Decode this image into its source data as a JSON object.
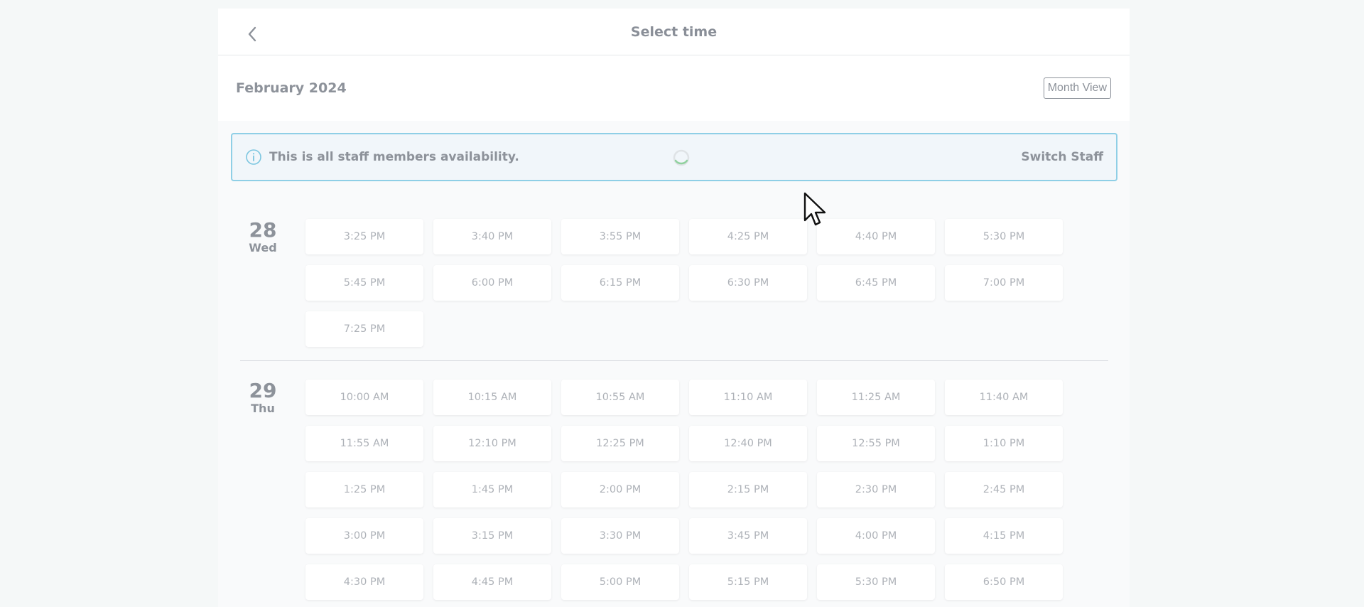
{
  "header": {
    "title": "Select time",
    "back_icon": "chevron-left-icon"
  },
  "month": {
    "label": "February 2024",
    "view_button": "Month View"
  },
  "info": {
    "icon": "info-icon",
    "text": "This is all staff members availability.",
    "action": "Switch Staff",
    "accent_color": "#8fcfe6"
  },
  "days": [
    {
      "num": "28",
      "name": "Wed",
      "slots": [
        "3:25 PM",
        "3:40 PM",
        "3:55 PM",
        "4:25 PM",
        "4:40 PM",
        "5:30 PM",
        "5:45 PM",
        "6:00 PM",
        "6:15 PM",
        "6:30 PM",
        "6:45 PM",
        "7:00 PM",
        "7:25 PM"
      ]
    },
    {
      "num": "29",
      "name": "Thu",
      "slots": [
        "10:00 AM",
        "10:15 AM",
        "10:55 AM",
        "11:10 AM",
        "11:25 AM",
        "11:40 AM",
        "11:55 AM",
        "12:10 PM",
        "12:25 PM",
        "12:40 PM",
        "12:55 PM",
        "1:10 PM",
        "1:25 PM",
        "1:45 PM",
        "2:00 PM",
        "2:15 PM",
        "2:30 PM",
        "2:45 PM",
        "3:00 PM",
        "3:15 PM",
        "3:30 PM",
        "3:45 PM",
        "4:00 PM",
        "4:15 PM",
        "4:30 PM",
        "4:45 PM",
        "5:00 PM",
        "5:15 PM",
        "5:30 PM",
        "6:50 PM"
      ]
    }
  ]
}
